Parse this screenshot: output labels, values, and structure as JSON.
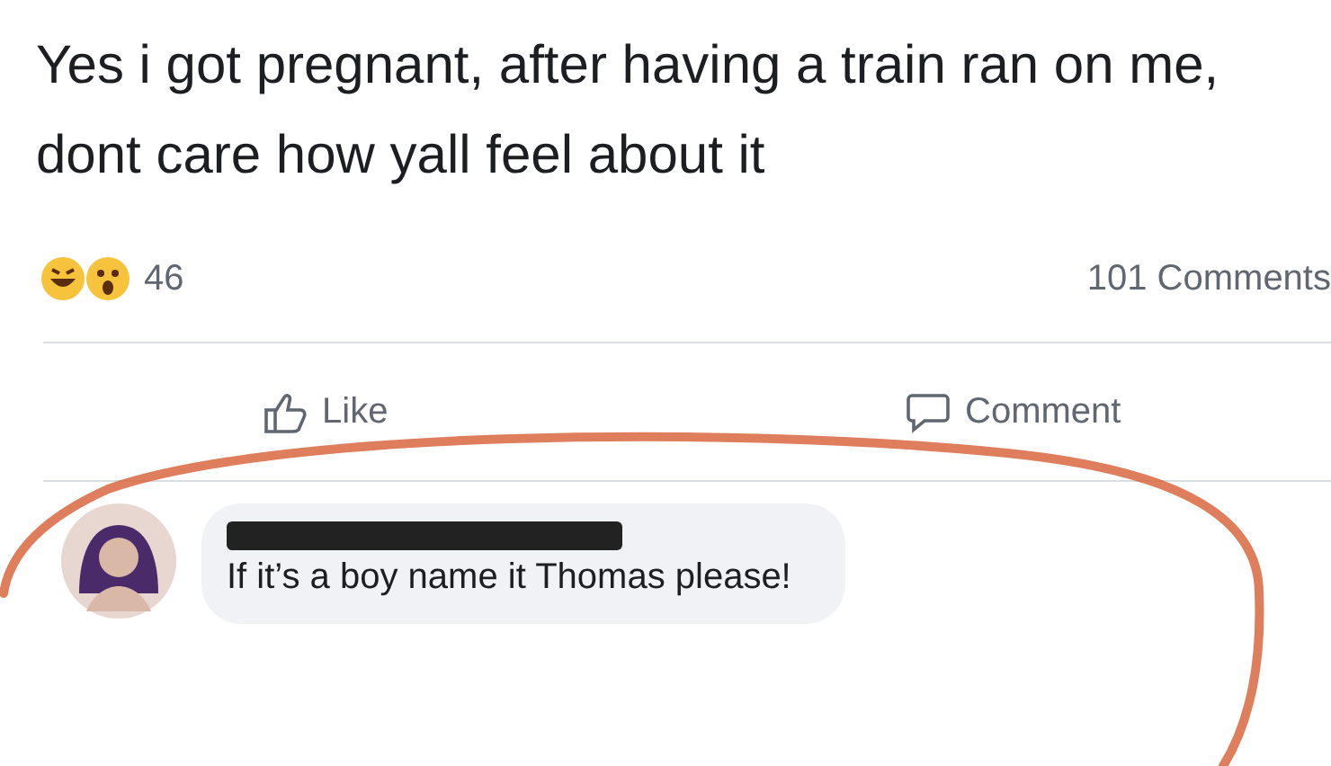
{
  "post": {
    "text": "Yes i got pregnant, after having a train ran on me, dont care how yall feel about it"
  },
  "reactions": {
    "count": "46",
    "comments": "101 Comments"
  },
  "actions": [
    {
      "kind": "like",
      "label": "Like"
    },
    {
      "kind": "comment",
      "label": "Comment"
    }
  ],
  "comment": {
    "text": "If it’s a boy name it Thomas please!"
  }
}
